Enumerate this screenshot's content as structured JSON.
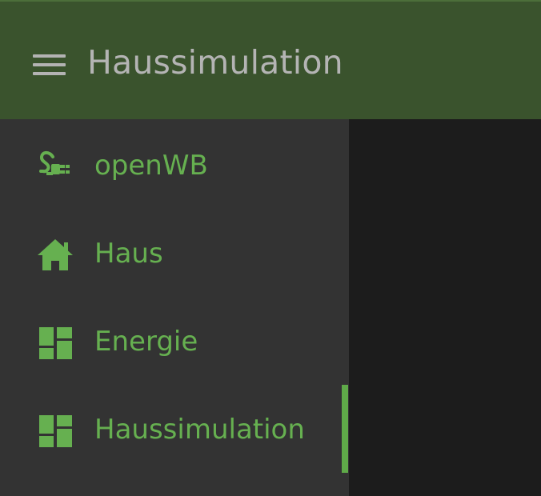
{
  "header": {
    "title": "Haussimulation",
    "menu_icon": "menu-icon"
  },
  "sidebar": {
    "items": [
      {
        "label": "openWB",
        "icon": "plug-icon",
        "active": false
      },
      {
        "label": "Haus",
        "icon": "home-icon",
        "active": false
      },
      {
        "label": "Energie",
        "icon": "dashboard-icon",
        "active": false
      },
      {
        "label": "Haussimulation",
        "icon": "dashboard-icon",
        "active": true
      }
    ]
  },
  "colors": {
    "header_bg": "#3a532d",
    "sidebar_bg": "#333333",
    "main_bg": "#1c1c1c",
    "accent": "#66b050",
    "header_text": "#b4b4b4"
  }
}
